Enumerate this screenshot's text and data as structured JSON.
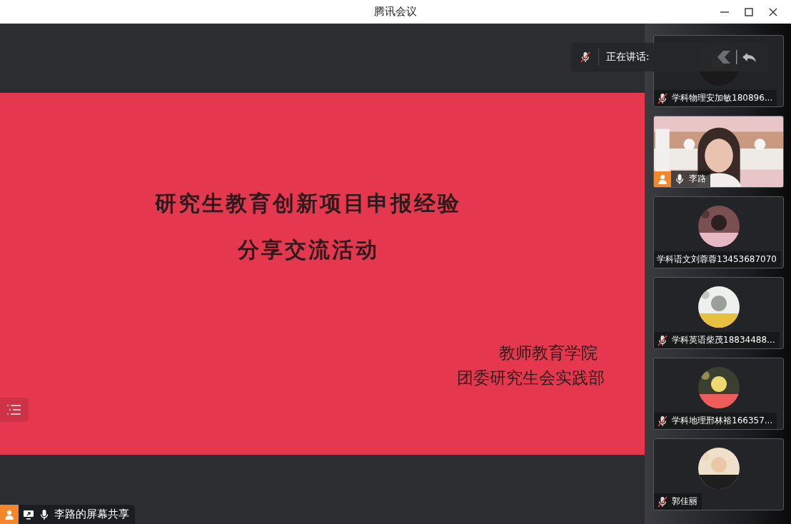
{
  "window": {
    "title": "腾讯会议"
  },
  "speaking": {
    "label": "正在讲话:"
  },
  "slide": {
    "title_lines": [
      "研究生教育创新项目申报经验",
      "分享交流活动"
    ],
    "credit_lines": [
      "教师教育学院",
      "团委研究生会实践部"
    ]
  },
  "share_label": {
    "text": "李路的屏幕共享"
  },
  "participants": [
    {
      "kind": "avatar",
      "name": "学科物理安加敏180896...",
      "mic": {
        "muted": true
      }
    },
    {
      "kind": "video",
      "name": "李路",
      "mic": {
        "muted": false
      },
      "host": true
    },
    {
      "kind": "avatar",
      "name": "学科语文刘蓉蓉13453687070"
    },
    {
      "kind": "avatar",
      "name": "学科英语柴茂18834488...",
      "mic": {
        "muted": true
      }
    },
    {
      "kind": "avatar",
      "name": "学科地理邢林裕166357...",
      "mic": {
        "muted": true
      }
    },
    {
      "kind": "avatar",
      "name": "郭佳丽",
      "mic": {
        "muted": true
      }
    }
  ]
}
